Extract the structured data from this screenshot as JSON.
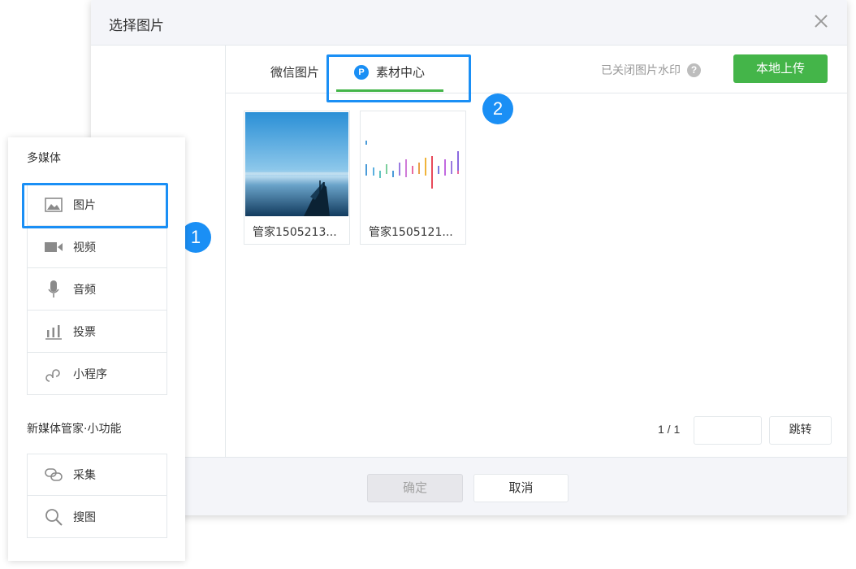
{
  "dialog": {
    "title": "选择图片",
    "tabs": [
      {
        "label": "微信图片"
      },
      {
        "label": "素材中心",
        "badge": "P",
        "active": true
      }
    ],
    "watermark_text": "已关闭图片水印",
    "help_icon": "?",
    "upload_label": "本地上传",
    "images": [
      {
        "name": "管家1505213..."
      },
      {
        "name": "管家1505121..."
      }
    ],
    "pagination": {
      "current": "1 / 1",
      "input_value": "",
      "jump_label": "跳转"
    },
    "footer": {
      "confirm_label": "确定",
      "cancel_label": "取消"
    }
  },
  "panel": {
    "section1_title": "多媒体",
    "section1_items": [
      {
        "label": "图片",
        "icon": "image-icon"
      },
      {
        "label": "视频",
        "icon": "video-camera-icon"
      },
      {
        "label": "音频",
        "icon": "microphone-icon"
      },
      {
        "label": "投票",
        "icon": "bar-chart-icon"
      },
      {
        "label": "小程序",
        "icon": "mini-program-icon"
      }
    ],
    "section2_title": "新媒体管家·小功能",
    "section2_items": [
      {
        "label": "采集",
        "icon": "collect-link-icon"
      },
      {
        "label": "搜图",
        "icon": "search-icon"
      }
    ]
  },
  "steps": [
    "1",
    "2"
  ],
  "colors": {
    "accent_green": "#44b549",
    "highlight_blue": "#1a8ff5"
  }
}
